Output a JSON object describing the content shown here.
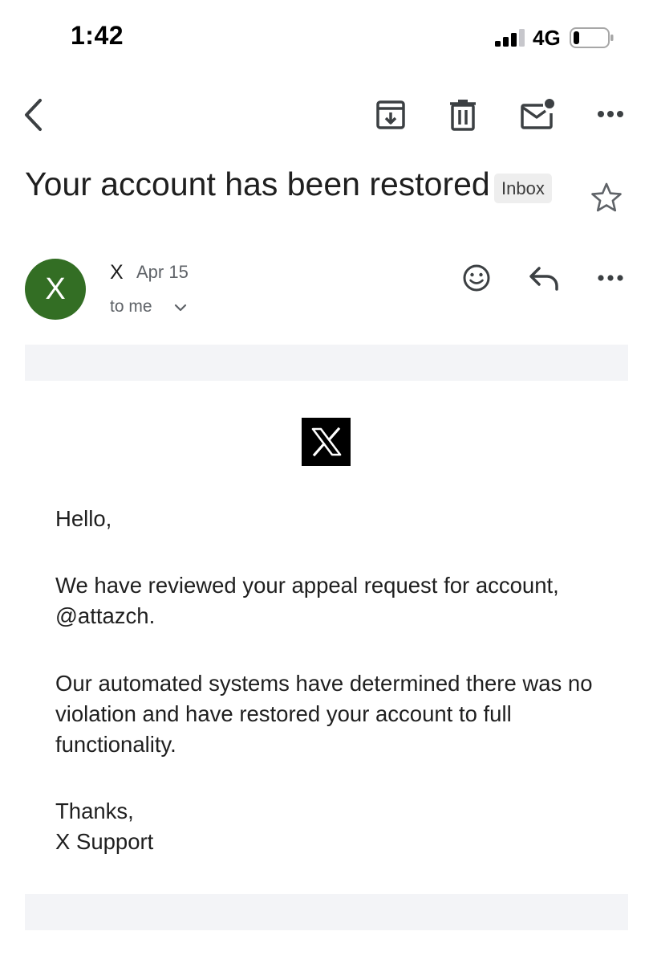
{
  "status_bar": {
    "time": "1:42",
    "network": "4G",
    "signal_bars_active": 3,
    "signal_bars_total": 4,
    "battery_level": 0.2
  },
  "toolbar": {
    "icons": [
      "back-arrow-icon",
      "archive-icon",
      "delete-icon",
      "mark-unread-icon",
      "more-icon"
    ]
  },
  "email": {
    "subject": "Your account has been restored",
    "label": "Inbox",
    "sender": {
      "initial": "X",
      "name": "X",
      "date": "Apr 15",
      "recipients": "to me",
      "avatar_color": "#336e24"
    },
    "body": {
      "greeting": "Hello,",
      "paragraph1": "We have reviewed your appeal request for account, @attazch.",
      "paragraph2": "Our automated systems have determined there was no violation and have restored your account to full functionality.",
      "signoff_line1": "Thanks,",
      "signoff_line2": "X Support"
    }
  }
}
